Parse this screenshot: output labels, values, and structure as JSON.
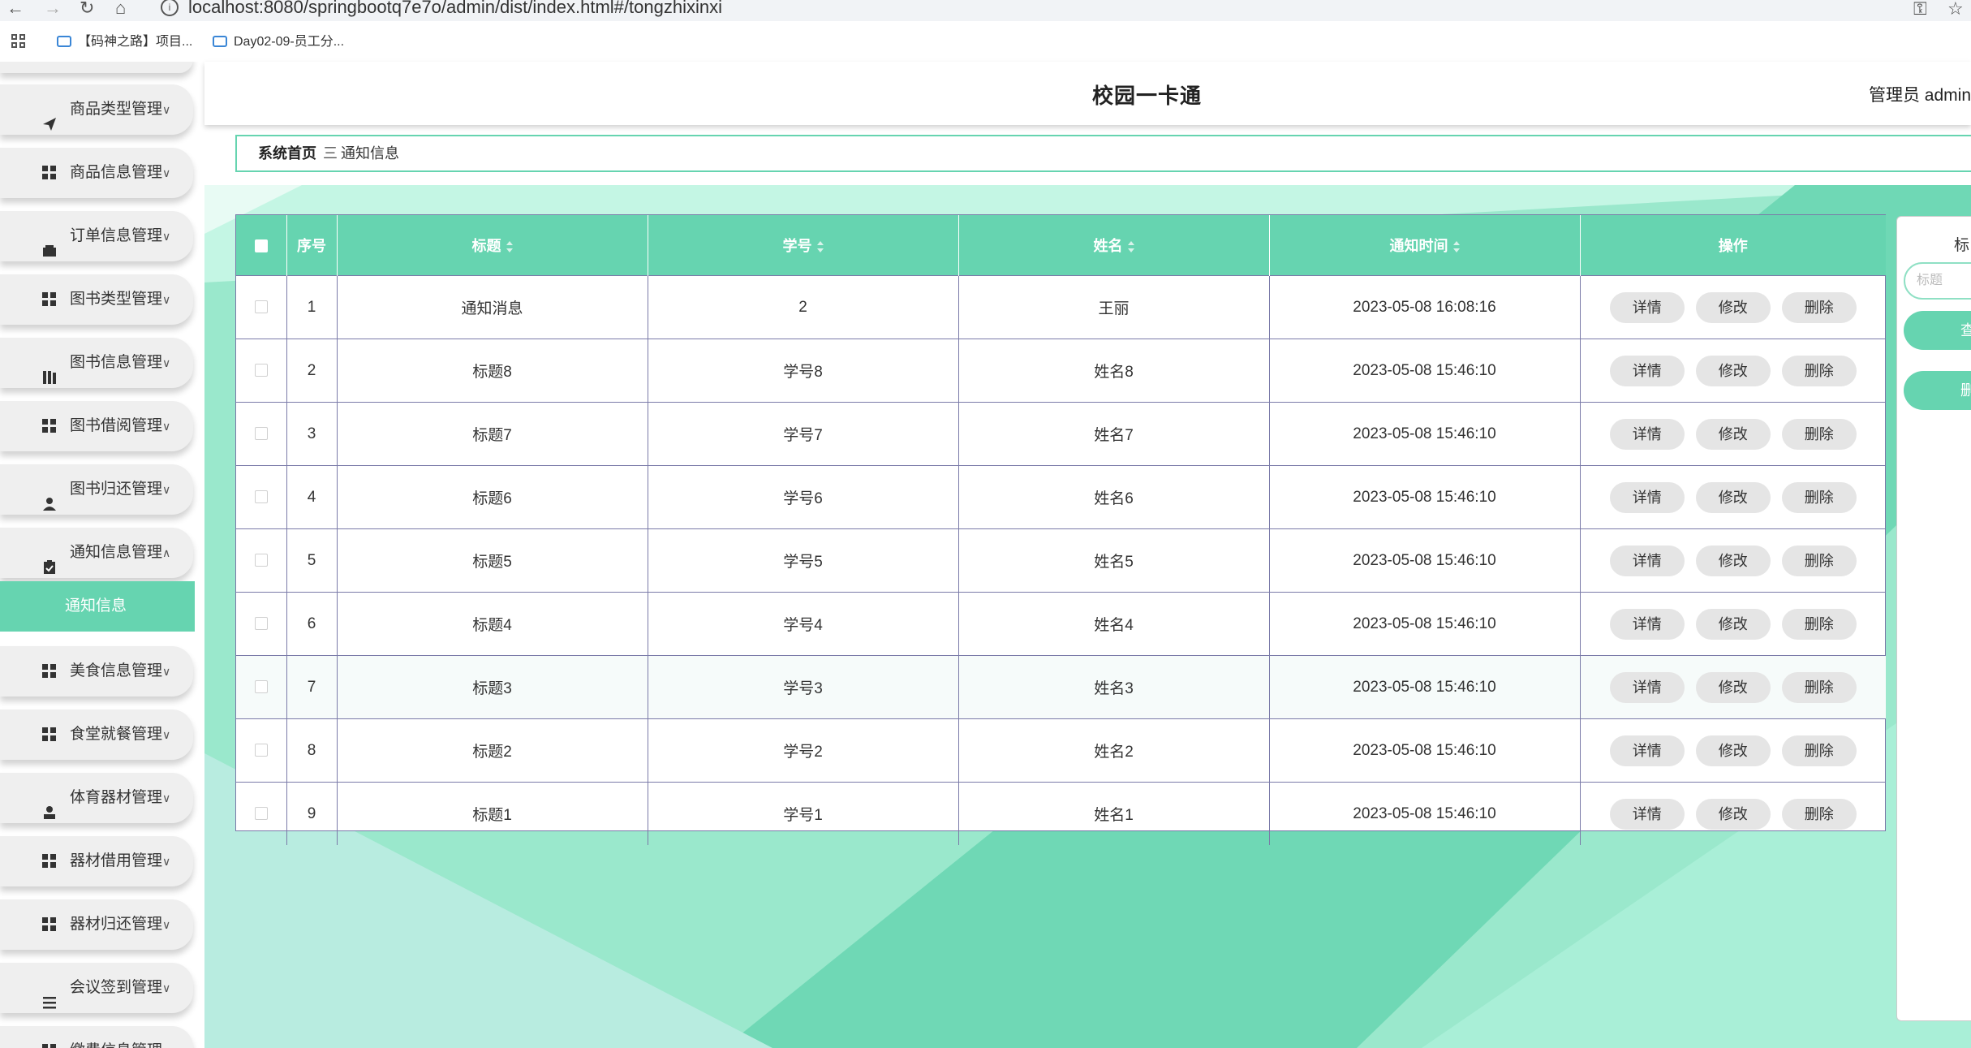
{
  "browser": {
    "url": "localhost:8080/springbootq7e7o/admin/dist/index.html#/tongzhixinxi",
    "bookmarks": [
      "【码神之路】项目...",
      "Day02-09-员工分..."
    ]
  },
  "header": {
    "title": "校园一卡通",
    "user": "管理员 admin"
  },
  "breadcrumb": {
    "home": "系统首页",
    "separator": "三",
    "current": "通知信息"
  },
  "sidebar": {
    "items": [
      {
        "label": "商品类型管理",
        "icon": "send-icon"
      },
      {
        "label": "商品信息管理",
        "icon": "grid-icon"
      },
      {
        "label": "订单信息管理",
        "icon": "wallet-icon"
      },
      {
        "label": "图书类型管理",
        "icon": "grid-icon"
      },
      {
        "label": "图书信息管理",
        "icon": "books-icon"
      },
      {
        "label": "图书借阅管理",
        "icon": "grid-icon"
      },
      {
        "label": "图书归还管理",
        "icon": "user-icon"
      },
      {
        "label": "通知信息管理",
        "icon": "clipboard-icon"
      },
      {
        "label": "美食信息管理",
        "icon": "grid-icon"
      },
      {
        "label": "食堂就餐管理",
        "icon": "grid-icon"
      },
      {
        "label": "体育器材管理",
        "icon": "person-icon"
      },
      {
        "label": "器材借用管理",
        "icon": "grid-icon"
      },
      {
        "label": "器材归还管理",
        "icon": "grid-icon"
      },
      {
        "label": "会议签到管理",
        "icon": "list-icon"
      },
      {
        "label": "缴费信息管理",
        "icon": "grid-icon"
      }
    ],
    "active_sub": "通知信息"
  },
  "table": {
    "headers": {
      "index": "序号",
      "title": "标题",
      "student_no": "学号",
      "name": "姓名",
      "time": "通知时间",
      "ops": "操作"
    },
    "rows": [
      {
        "index": "1",
        "title": "通知消息",
        "student_no": "2",
        "name": "王丽",
        "time": "2023-05-08 16:08:16"
      },
      {
        "index": "2",
        "title": "标题8",
        "student_no": "学号8",
        "name": "姓名8",
        "time": "2023-05-08 15:46:10"
      },
      {
        "index": "3",
        "title": "标题7",
        "student_no": "学号7",
        "name": "姓名7",
        "time": "2023-05-08 15:46:10"
      },
      {
        "index": "4",
        "title": "标题6",
        "student_no": "学号6",
        "name": "姓名6",
        "time": "2023-05-08 15:46:10"
      },
      {
        "index": "5",
        "title": "标题5",
        "student_no": "学号5",
        "name": "姓名5",
        "time": "2023-05-08 15:46:10"
      },
      {
        "index": "6",
        "title": "标题4",
        "student_no": "学号4",
        "name": "姓名4",
        "time": "2023-05-08 15:46:10"
      },
      {
        "index": "7",
        "title": "标题3",
        "student_no": "学号3",
        "name": "姓名3",
        "time": "2023-05-08 15:46:10"
      },
      {
        "index": "8",
        "title": "标题2",
        "student_no": "学号2",
        "name": "姓名2",
        "time": "2023-05-08 15:46:10"
      },
      {
        "index": "9",
        "title": "标题1",
        "student_no": "学号1",
        "name": "姓名1",
        "time": "2023-05-08 15:46:10"
      }
    ],
    "actions": {
      "detail": "详情",
      "edit": "修改",
      "delete": "删除"
    }
  },
  "search_panel": {
    "label": "标",
    "placeholder": "标题",
    "query_btn": "查",
    "delete_btn": "删"
  },
  "colors": {
    "accent": "#66d4b0",
    "accent_light": "#c2f5e2",
    "border": "#7a7aa8"
  }
}
